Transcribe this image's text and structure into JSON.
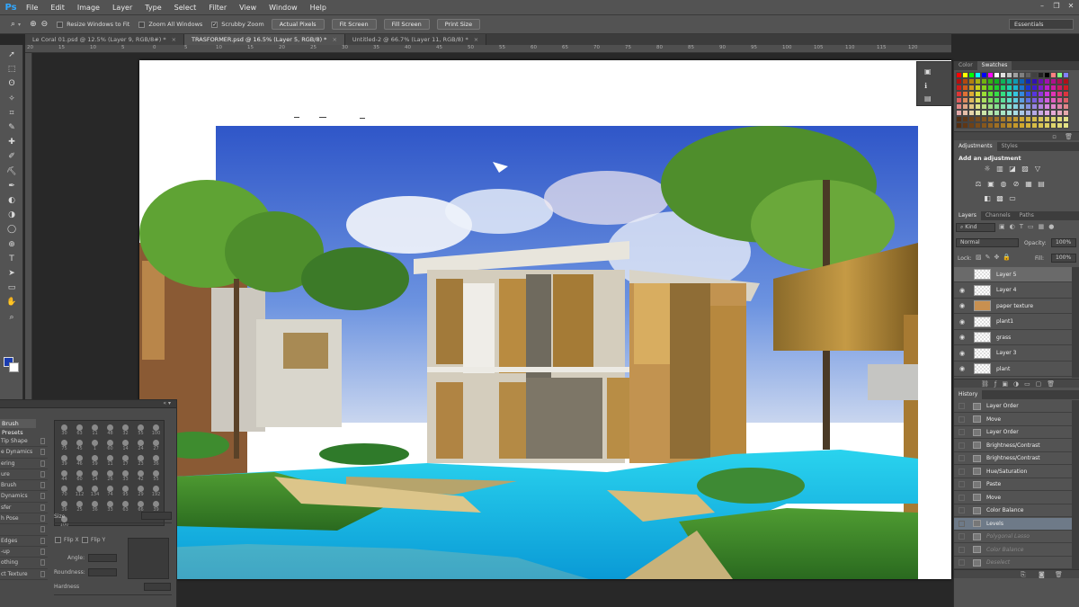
{
  "app": {
    "logo": "Ps"
  },
  "menu": [
    "File",
    "Edit",
    "Image",
    "Layer",
    "Type",
    "Select",
    "Filter",
    "View",
    "Window",
    "Help"
  ],
  "window_controls": {
    "minimize": "–",
    "restore": "❐",
    "close": "✕"
  },
  "options": {
    "resize_windows": "Resize Windows to Fit",
    "zoom_all": "Zoom All Windows",
    "scrubby_zoom": "Scrubby Zoom",
    "buttons": [
      "Actual Pixels",
      "Fit Screen",
      "Fill Screen",
      "Print Size"
    ],
    "workspace": "Essentials"
  },
  "tabs": [
    {
      "label": "Le Coral 01.psd @ 12.5% (Layer 9, RGB/8#) *",
      "close": "×"
    },
    {
      "label": "TRASFORMER.psd @ 16.5% (Layer 5, RGB/8) *",
      "close": "×"
    },
    {
      "label": "Untitled-2 @ 66.7% (Layer 11, RGB/8) *",
      "close": "×"
    }
  ],
  "ruler_marks": [
    "20",
    "15",
    "10",
    "5",
    "0",
    "5",
    "10",
    "15",
    "20",
    "25",
    "30",
    "35",
    "40",
    "45",
    "50",
    "55",
    "60",
    "65",
    "70",
    "75",
    "80",
    "85",
    "90",
    "95",
    "100",
    "105",
    "110",
    "115",
    "120"
  ],
  "tools": [
    "➚",
    "⬚",
    "ʘ",
    "✧",
    "⌗",
    "✎",
    "✚",
    "✐",
    "⛏",
    "✒",
    "◐",
    "◑",
    "◯",
    "⊕",
    "T",
    "➤",
    "▭",
    "✋",
    "⌕"
  ],
  "brush": {
    "tab": "Brush Presets",
    "items": [
      "Tip Shape",
      "e Dynamics",
      "ering",
      "ure",
      "Brush",
      "Dynamics",
      "sfer",
      "h Pose",
      "",
      "Edges",
      "-up",
      "othing",
      "ct Texture"
    ],
    "sizes": [
      "30",
      "63",
      "11",
      "48",
      "32",
      "55",
      "100",
      "75",
      "45",
      "1",
      "60",
      "14",
      "24",
      "27",
      "39",
      "46",
      "59",
      "11",
      "17",
      "23",
      "36",
      "44",
      "60",
      "14",
      "26",
      "33",
      "42",
      "55",
      "70",
      "112",
      "134",
      "74",
      "95",
      "29",
      "192",
      "36",
      "25",
      "36",
      "33",
      "63",
      "66",
      "39",
      "100"
    ],
    "size_label": "Size",
    "flip_x": "Flip X",
    "flip_y": "Flip Y",
    "angle": "Angle:",
    "roundness": "Roundness:",
    "hardness": "Hardness"
  },
  "panels": {
    "color_tabs": [
      "Color",
      "Swatches"
    ],
    "adjust_tabs": [
      "Adjustments",
      "Styles"
    ],
    "adjust_title": "Add an adjustment",
    "adjust_icons": [
      "☼",
      "▥",
      "◪",
      "▨",
      "▽",
      "⚖",
      "▣",
      "◍",
      "⊘",
      "▦",
      "▤",
      "◧",
      "▩",
      "▭"
    ],
    "layers_tabs": [
      "Layers",
      "Channels",
      "Paths"
    ],
    "kind": "Kind",
    "blend": "Normal",
    "opacity": "Opacity:",
    "opacity_val": "100%",
    "lock": "Lock:",
    "fill": "Fill:",
    "fill_val": "100%",
    "layers": [
      {
        "name": "Layer 5",
        "selected": true,
        "visible": false,
        "texture": false
      },
      {
        "name": "Layer 4",
        "selected": false,
        "visible": true,
        "texture": false
      },
      {
        "name": "paper texture",
        "selected": false,
        "visible": true,
        "texture": true
      },
      {
        "name": "plant1",
        "selected": false,
        "visible": true,
        "texture": false
      },
      {
        "name": "grass",
        "selected": false,
        "visible": true,
        "texture": false
      },
      {
        "name": "Layer 3",
        "selected": false,
        "visible": true,
        "texture": false
      },
      {
        "name": "plant",
        "selected": false,
        "visible": true,
        "texture": false
      }
    ],
    "history_tab": "History",
    "history": [
      {
        "name": "Layer Order",
        "state": "normal"
      },
      {
        "name": "Move",
        "state": "normal"
      },
      {
        "name": "Layer Order",
        "state": "normal"
      },
      {
        "name": "Brightness/Contrast",
        "state": "normal"
      },
      {
        "name": "Brightness/Contrast",
        "state": "normal"
      },
      {
        "name": "Hue/Saturation",
        "state": "normal"
      },
      {
        "name": "Paste",
        "state": "normal"
      },
      {
        "name": "Move",
        "state": "normal"
      },
      {
        "name": "Color Balance",
        "state": "normal"
      },
      {
        "name": "Levels",
        "state": "current"
      },
      {
        "name": "Polygonal Lasso",
        "state": "dim"
      },
      {
        "name": "Color Balance",
        "state": "dim"
      },
      {
        "name": "Deselect",
        "state": "dim"
      }
    ]
  },
  "colors": {
    "accent": "#31a8ff",
    "fg": "#1a3cb0",
    "bg": "#ffffff",
    "ui": "#535353"
  }
}
